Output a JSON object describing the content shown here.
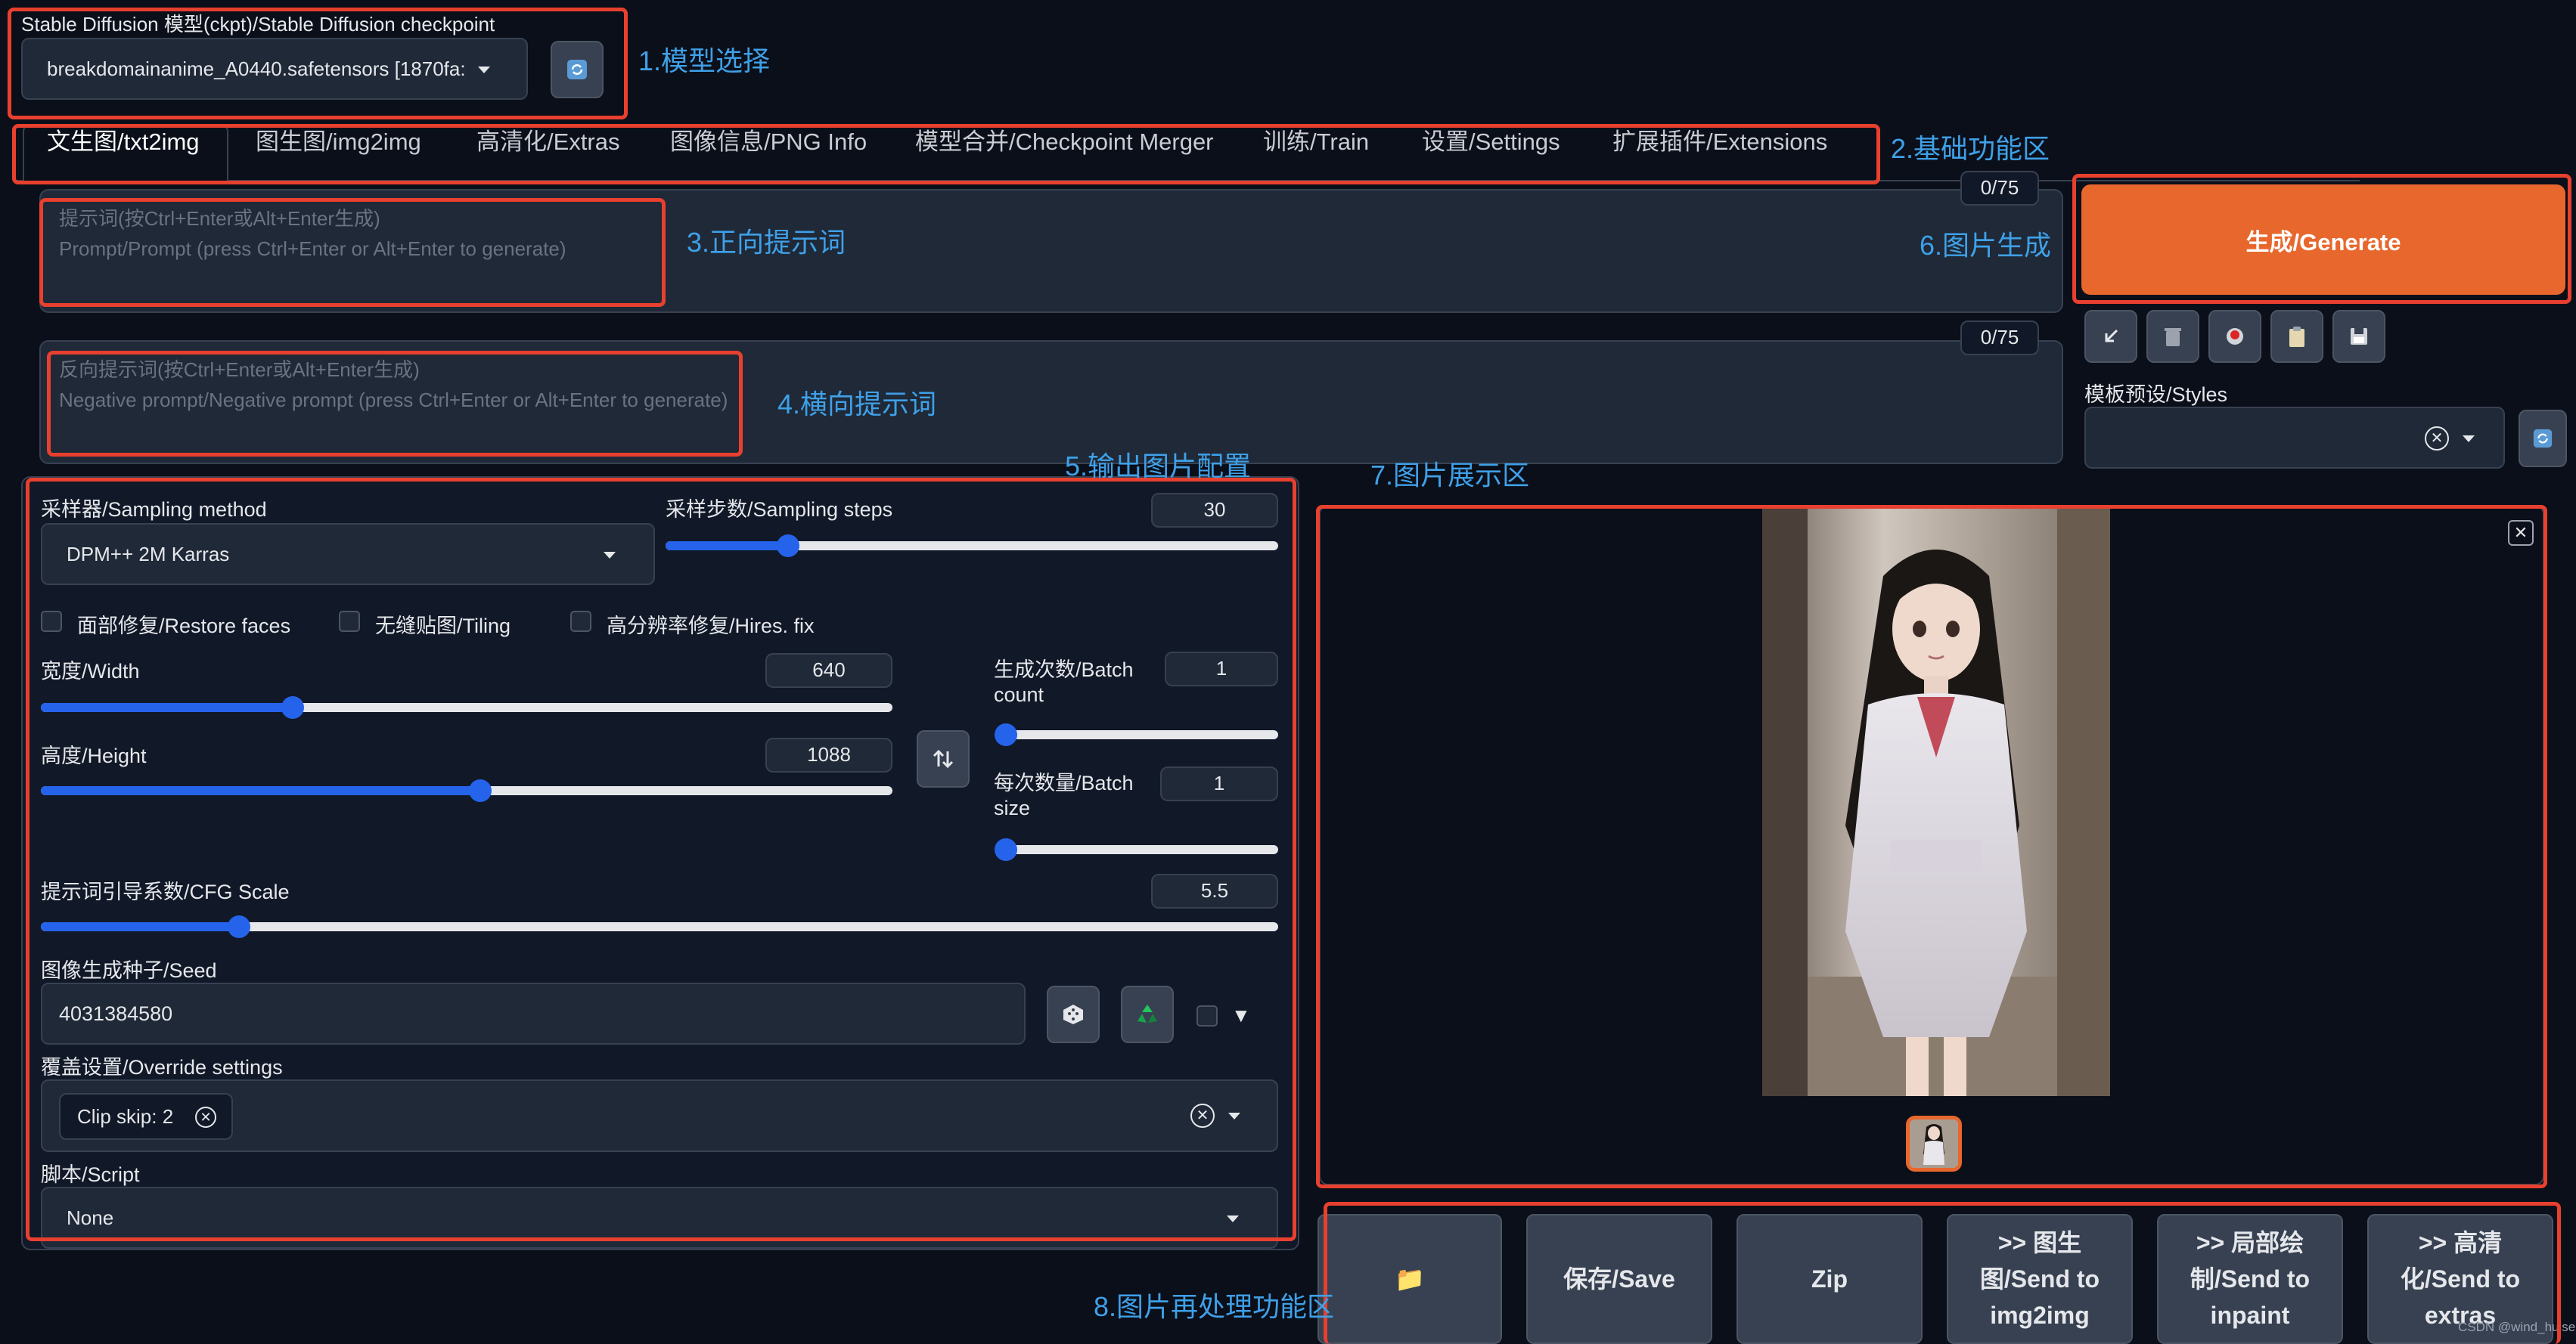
{
  "checkpoint": {
    "label": "Stable Diffusion 模型(ckpt)/Stable Diffusion checkpoint",
    "value": "breakdomainanime_A0440.safetensors [1870fa:",
    "refresh_icon": "refresh-icon"
  },
  "tabs": [
    {
      "label": "文生图/txt2img",
      "active": true
    },
    {
      "label": "图生图/img2img"
    },
    {
      "label": "高清化/Extras"
    },
    {
      "label": "图像信息/PNG Info"
    },
    {
      "label": "模型合并/Checkpoint Merger"
    },
    {
      "label": "训练/Train"
    },
    {
      "label": "设置/Settings"
    },
    {
      "label": "扩展插件/Extensions"
    }
  ],
  "prompt": {
    "placeholder_line1": "提示词(按Ctrl+Enter或Alt+Enter生成)",
    "placeholder_line2": "Prompt/Prompt (press Ctrl+Enter or Alt+Enter to generate)",
    "counter": "0/75"
  },
  "negative_prompt": {
    "placeholder_line1": "反向提示词(按Ctrl+Enter或Alt+Enter生成)",
    "placeholder_line2": "Negative prompt/Negative prompt (press Ctrl+Enter or Alt+Enter to generate)",
    "counter": "0/75"
  },
  "generate": {
    "label": "生成/Generate",
    "color": "#e8672d",
    "tools": [
      "arrow-icon",
      "trash-icon",
      "record-icon",
      "clipboard-icon",
      "save-icon"
    ]
  },
  "styles": {
    "label": "模板预设/Styles"
  },
  "settings": {
    "sampler": {
      "label": "采样器/Sampling method",
      "value": "DPM++ 2M Karras"
    },
    "steps": {
      "label": "采样步数/Sampling steps",
      "value": "30",
      "fraction": 0.2
    },
    "restore_faces": "面部修复/Restore faces",
    "tiling": "无缝贴图/Tiling",
    "hires_fix": "高分辨率修复/Hires. fix",
    "width": {
      "label": "宽度/Width",
      "value": "640",
      "fraction": 0.296
    },
    "height": {
      "label": "高度/Height",
      "value": "1088",
      "fraction": 0.516
    },
    "batch_count": {
      "label1": "生成次数/Batch",
      "label2": "count",
      "value": "1",
      "fraction": 0.0
    },
    "batch_size": {
      "label1": "每次数量/Batch",
      "label2": "size",
      "value": "1",
      "fraction": 0.0
    },
    "cfg": {
      "label": "提示词引导系数/CFG Scale",
      "value": "5.5",
      "fraction": 0.16
    },
    "seed": {
      "label": "图像生成种子/Seed",
      "value": "4031384580"
    },
    "override": {
      "label": "覆盖设置/Override settings",
      "chip": "Clip skip: 2"
    },
    "script": {
      "label": "脚本/Script",
      "value": "None"
    }
  },
  "output_actions": [
    {
      "label": "📁",
      "icon": "folder-icon"
    },
    {
      "label": "保存/Save"
    },
    {
      "label": "Zip"
    },
    {
      "label": ">> 图生\n图/Send to\nimg2img"
    },
    {
      "label": ">> 局部绘\n制/Send to\ninpaint"
    },
    {
      "label": ">> 高清\n化/Send to\nextras"
    }
  ],
  "annotations": {
    "a1": "1.模型选择",
    "a2": "2.基础功能区",
    "a3": "3.正向提示词",
    "a4": "4.横向提示词",
    "a5": "5.输出图片配置",
    "a6": "6.图片生成",
    "a7": "7.图片展示区",
    "a8": "8.图片再处理功能区",
    "color": "#e8402f"
  },
  "watermark": "CSDN @wind_huise"
}
